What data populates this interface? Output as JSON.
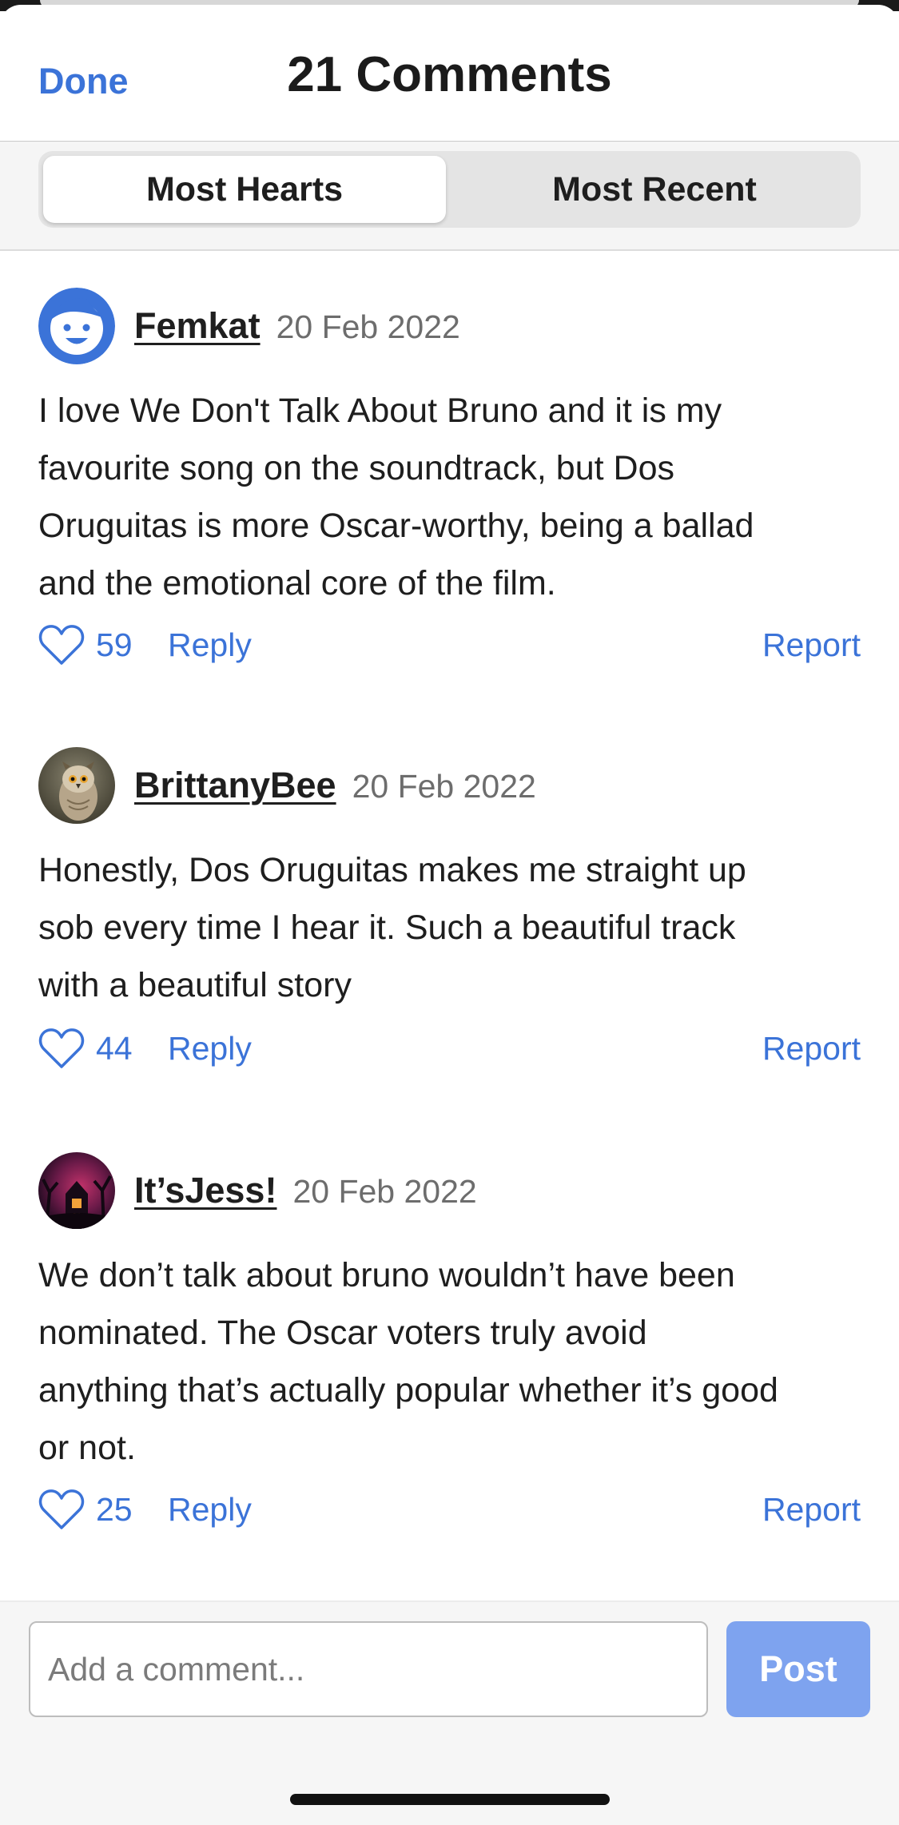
{
  "header": {
    "done_label": "Done",
    "title": "21 Comments"
  },
  "sort_tabs": [
    {
      "label": "Most Hearts",
      "active": true
    },
    {
      "label": "Most Recent",
      "active": false
    }
  ],
  "comments": [
    {
      "username": "Femkat",
      "date": "20 Feb 2022",
      "avatar": "smiley-face-icon",
      "lines": [
        "I love We Don't Talk About Bruno and it is my",
        "favourite song on the soundtrack, but Dos",
        "Oruguitas is more Oscar-worthy, being a ballad",
        "and the emotional core of the film."
      ],
      "hearts": "59",
      "reply_label": "Reply",
      "report_label": "Report"
    },
    {
      "username": "BrittanyBee",
      "date": "20 Feb 2022",
      "avatar": "owl-photo",
      "lines": [
        "Honestly, Dos Oruguitas makes me straight up",
        "sob every time I hear it.  Such a beautiful track",
        "with a beautiful story"
      ],
      "hearts": "44",
      "reply_label": "Reply",
      "report_label": "Report"
    },
    {
      "username": "It’sJess!",
      "date": "20 Feb 2022",
      "avatar": "spooky-house-photo",
      "lines": [
        "We don’t talk about bruno wouldn’t have been",
        "nominated. The Oscar voters truly avoid",
        "anything that’s actually popular whether it’s good",
        "or not."
      ],
      "hearts": "25",
      "reply_label": "Reply",
      "report_label": "Report"
    }
  ],
  "composer": {
    "placeholder": "Add a comment...",
    "value": "",
    "post_label": "Post"
  },
  "colors": {
    "accent": "#3b73d8",
    "post_button": "#7ea3ef",
    "text": "#1e1e1e",
    "muted": "#6d6d6d"
  }
}
